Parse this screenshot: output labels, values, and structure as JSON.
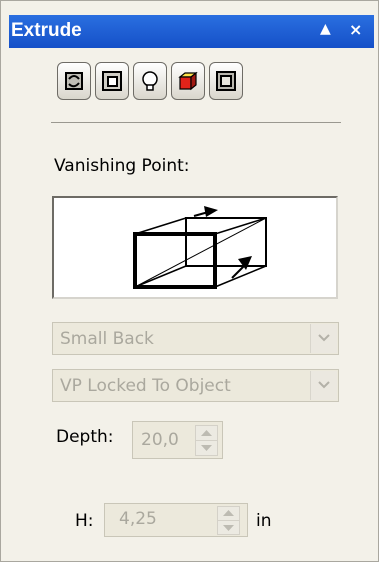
{
  "window": {
    "title": "Extrude"
  },
  "titlebar_buttons": {
    "up": "▲",
    "close": "×"
  },
  "toolbar": {
    "tools": [
      {
        "name": "extrude-rotation-icon"
      },
      {
        "name": "extrude-bevel-icon"
      },
      {
        "name": "extrude-lighting-icon"
      },
      {
        "name": "extrude-color-icon"
      },
      {
        "name": "extrude-type-icon"
      }
    ]
  },
  "vanishing_point": {
    "label": "Vanishing Point:",
    "preset": {
      "value": "Small Back"
    },
    "lock": {
      "value": "VP Locked To Object"
    }
  },
  "depth": {
    "label": "Depth:",
    "value": "20,0"
  },
  "h": {
    "label": "H:",
    "value": "4,25",
    "unit": "in"
  },
  "colors": {
    "titlebar": "#1f5fd8",
    "panel": "#f3f1e9",
    "disabled_text": "#aaa89e"
  }
}
